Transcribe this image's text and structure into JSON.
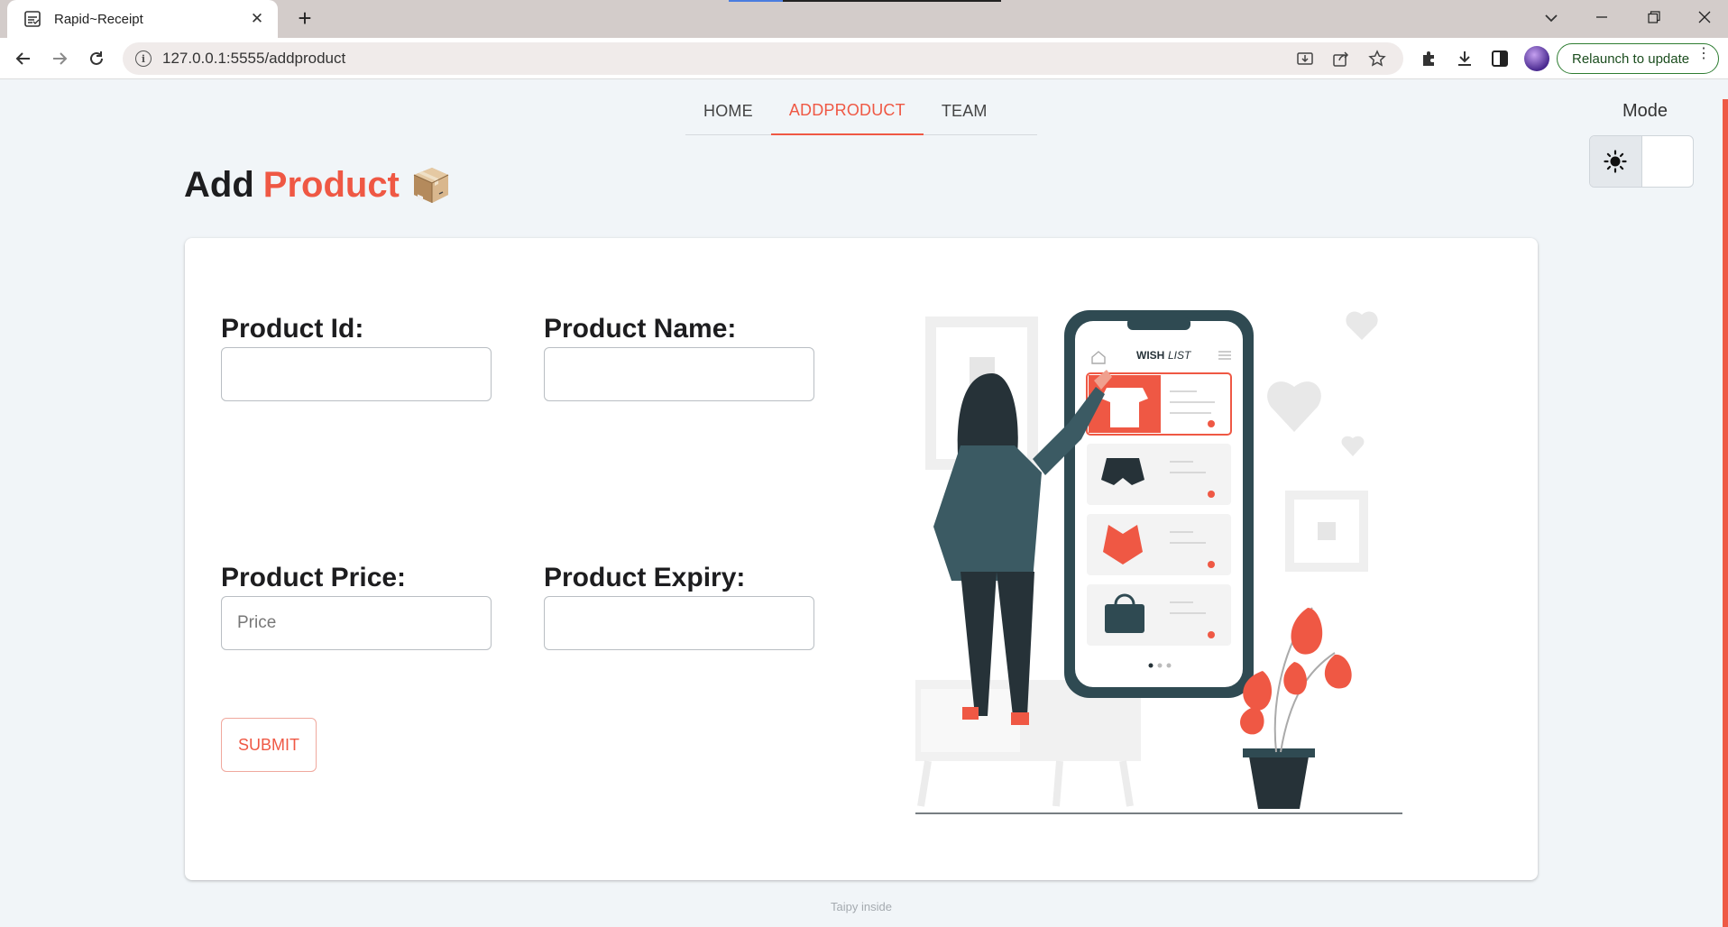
{
  "browser": {
    "tab_title": "Rapid~Receipt",
    "url": "127.0.0.1:5555/addproduct",
    "relaunch_label": "Relaunch to update"
  },
  "nav": {
    "items": [
      {
        "label": "HOME",
        "active": false
      },
      {
        "label": "ADDPRODUCT",
        "active": true
      },
      {
        "label": "TEAM",
        "active": false
      }
    ]
  },
  "mode": {
    "label": "Mode",
    "selected": "light"
  },
  "page": {
    "title_prefix": "Add",
    "title_accent": "Product",
    "title_icon": "package-box-icon"
  },
  "form": {
    "product_id_label": "Product Id:",
    "product_id_value": "",
    "product_name_label": "Product Name:",
    "product_name_value": "",
    "product_price_label": "Product Price:",
    "product_price_placeholder": "Price",
    "product_expiry_label": "Product Expiry:",
    "product_expiry_value": "",
    "submit_label": "SUBMIT"
  },
  "illustration": {
    "app_title_bold": "WISH",
    "app_title_light": "LIST"
  },
  "footer": {
    "text": "Taipy inside"
  },
  "colors": {
    "accent": "#ef5844",
    "page_bg": "#f1f5f8",
    "dark_teal": "#2f4a52"
  }
}
